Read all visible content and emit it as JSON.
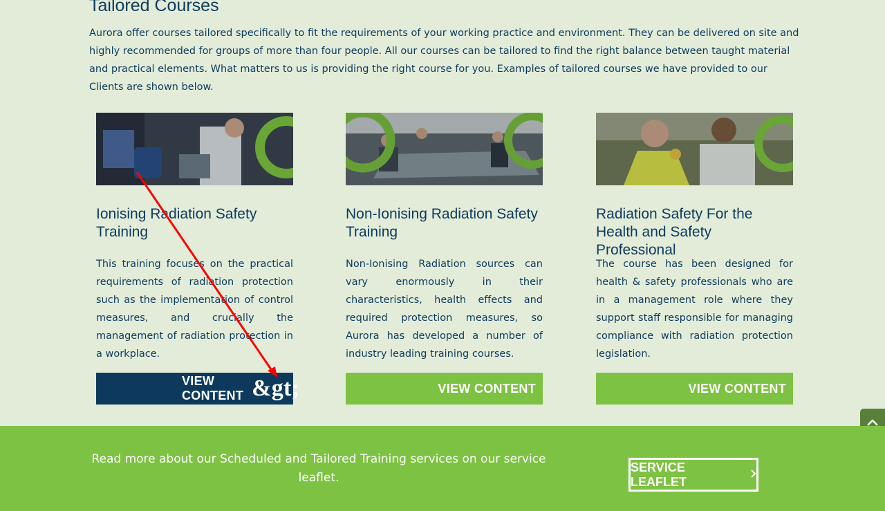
{
  "section": {
    "title": "Tailored Courses",
    "intro": "Aurora offer courses tailored specifically to fit the requirements of your working practice and environment. They can be delivered on site and highly recommended for groups of more than four people. All our courses can be tailored to find the right balance between taught material and practical elements. What matters to us is providing the right course for you. Examples of tailored courses we have provided to our Clients are shown below."
  },
  "cards": [
    {
      "title": "Ionising Radiation Safety Training",
      "body": "This training focuses on the practical requirements of radiation protection such as the implementation of control measures, and crucially the management of radiation protection in a workplace.",
      "button_label": "VIEW CONTENT",
      "button_suffix": "&gt;"
    },
    {
      "title": "Non-Ionising Radiation Safety Training",
      "body": "Non-Ionising Radiation sources can vary enormously in their characteristics, health effects and required protection measures, so Aurora has developed a number of industry leading training courses.",
      "button_label": "VIEW CONTENT"
    },
    {
      "title": "Radiation Safety For the Health and Safety Professional",
      "body": "The course has been designed for health & safety professionals who are in a management role where they support staff responsible for managing compliance with radiation protection legislation.",
      "button_label": "VIEW CONTENT"
    }
  ],
  "footer": {
    "text": "Read more about our Scheduled and Tailored Training services on our service leaflet.",
    "leaflet_label": "SERVICE LEAFLET"
  },
  "colors": {
    "page_bg": "#e3ecd9",
    "navy": "#0d3a5c",
    "green": "#7dc242",
    "annotation_arrow": "#ff0000"
  }
}
